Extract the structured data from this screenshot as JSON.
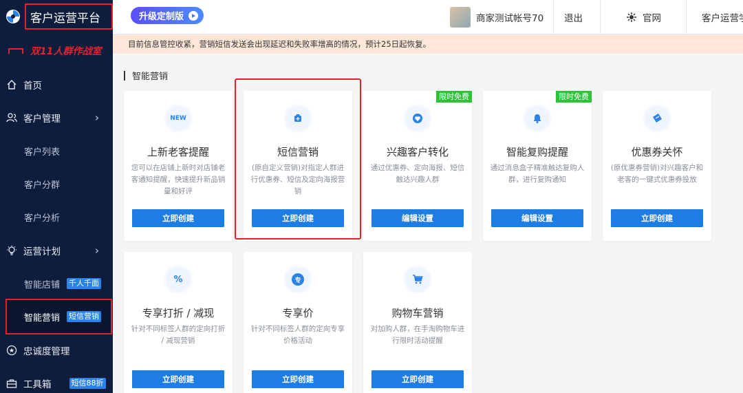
{
  "sidebar": {
    "brand_title": "客户运营平台",
    "promo_text": "双11人群作战室",
    "items": [
      {
        "label": "首页",
        "icon": "home-icon"
      },
      {
        "label": "客户管理",
        "icon": "users-icon"
      },
      {
        "label": "客户列表"
      },
      {
        "label": "客户分群"
      },
      {
        "label": "客户分析"
      },
      {
        "label": "运营计划",
        "icon": "bulb-icon"
      },
      {
        "label": "智能店铺",
        "badge": "千人千面"
      },
      {
        "label": "智能营销",
        "badge": "短信营销"
      },
      {
        "label": "忠诚度管理",
        "icon": "star-icon"
      },
      {
        "label": "工具箱",
        "icon": "toolbox-icon",
        "badge": "短信88折"
      }
    ]
  },
  "topbar": {
    "upgrade_label": "升级定制版",
    "account_name": "商家测试帐号70",
    "logout_label": "退出",
    "site_label": "官网",
    "cut_label": "客户运营学"
  },
  "notice": "目前信息管控收紧，营销短信发送会出现延迟和失败率增高的情况，预计25日起恢复。",
  "section_title": "智能营销",
  "cards": [
    {
      "title": "上新老客提醒",
      "desc": "您可以在店铺上新时对店铺老客通知提醒，快速提升新品销量和好评",
      "button": "立即创建",
      "icon": "new-icon",
      "icon_text": "NEW"
    },
    {
      "title": "短信营销",
      "desc": "(原自定义营销)对指定人群进行优惠券、短信及定向海报营销",
      "button": "立即创建",
      "icon": "sms-icon"
    },
    {
      "title": "兴趣客户转化",
      "desc": "通过优惠券、定向海报、短信触达兴趣人群",
      "button": "编辑设置",
      "icon": "heart-icon",
      "tag": "限时免费"
    },
    {
      "title": "智能复购提醒",
      "desc": "通过消息盒子精准触达复购人群，进行复购通知",
      "button": "编辑设置",
      "icon": "bell-icon",
      "tag": "限时免费"
    },
    {
      "title": "优惠券关怀",
      "desc": "(原优惠券营销)对兴趣客户和老客的一键式优惠券投放",
      "button": "立即创建",
      "icon": "ticket-icon"
    },
    {
      "title": "专享打折 / 减现",
      "desc": "针对不同标签人群的定向打折 / 减现营销",
      "button": "立即创建",
      "icon": "percent-icon",
      "icon_text": "%"
    },
    {
      "title": "专享价",
      "desc": "针对不同标签人群的定向专享价格活动",
      "button": "立即创建",
      "icon": "price-tag-icon",
      "icon_text": "专"
    },
    {
      "title": "购物车营销",
      "desc": "对加购人群，在手淘购物车进行限时活动提醒",
      "button": "立即创建",
      "icon": "cart-icon"
    }
  ],
  "colors": {
    "sidebar_bg": "#0f1d3c",
    "accent": "#1e7de2",
    "highlight": "#e3222b",
    "tag_green": "#2ec236",
    "notice_bg": "#fde7d9"
  }
}
